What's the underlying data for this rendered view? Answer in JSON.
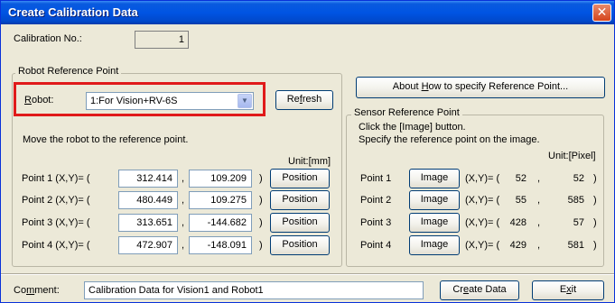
{
  "window": {
    "title": "Create Calibration Data",
    "close_symbol": "✕"
  },
  "calibration": {
    "label": "Calibration No.:",
    "value": "1"
  },
  "robot_ref": {
    "group_label": "Robot Reference Point",
    "robot_label": "Robot:",
    "robot_value": "1:For Vision+RV-6S",
    "refresh_label": "Refresh",
    "instruction": "Move the robot to the reference point.",
    "unit": "Unit:[mm]",
    "points": [
      {
        "label": "Point 1 (X,Y)= (",
        "x": "312.414",
        "comma": ",",
        "y": "109.209",
        "close": ")",
        "button": "Position"
      },
      {
        "label": "Point 2 (X,Y)= (",
        "x": "480.449",
        "comma": ",",
        "y": "109.275",
        "close": ")",
        "button": "Position"
      },
      {
        "label": "Point 3 (X,Y)= (",
        "x": "313.651",
        "comma": ",",
        "y": "-144.682",
        "close": ")",
        "button": "Position"
      },
      {
        "label": "Point 4 (X,Y)= (",
        "x": "472.907",
        "comma": ",",
        "y": "-148.091",
        "close": ")",
        "button": "Position"
      }
    ]
  },
  "about_button": "About How to specify Reference Point...",
  "sensor_ref": {
    "group_label": "Sensor Reference Point",
    "instruction_line1": "Click the [Image] button.",
    "instruction_line2": "Specify the reference point on the image.",
    "unit": "Unit:[Pixel]",
    "points": [
      {
        "label": "Point 1",
        "button": "Image",
        "prefix": "(X,Y)= (",
        "x": "52",
        "sep": ",",
        "y": "52",
        "close": ")"
      },
      {
        "label": "Point 2",
        "button": "Image",
        "prefix": "(X,Y)= (",
        "x": "55",
        "sep": ",",
        "y": "585",
        "close": ")"
      },
      {
        "label": "Point 3",
        "button": "Image",
        "prefix": "(X,Y)= (",
        "x": "428",
        "sep": ",",
        "y": "57",
        "close": ")"
      },
      {
        "label": "Point 4",
        "button": "Image",
        "prefix": "(X,Y)= (",
        "x": "429",
        "sep": ",",
        "y": "581",
        "close": ")"
      }
    ]
  },
  "comment": {
    "label": "Comment:",
    "value": "Calibration Data for Vision1 and Robot1"
  },
  "footer": {
    "create_label": "Create Data",
    "exit_label": "Exit"
  },
  "colors": {
    "title_bar": "#0054e3",
    "dialog_bg": "#ece9d8",
    "highlight": "#e01a1a"
  }
}
